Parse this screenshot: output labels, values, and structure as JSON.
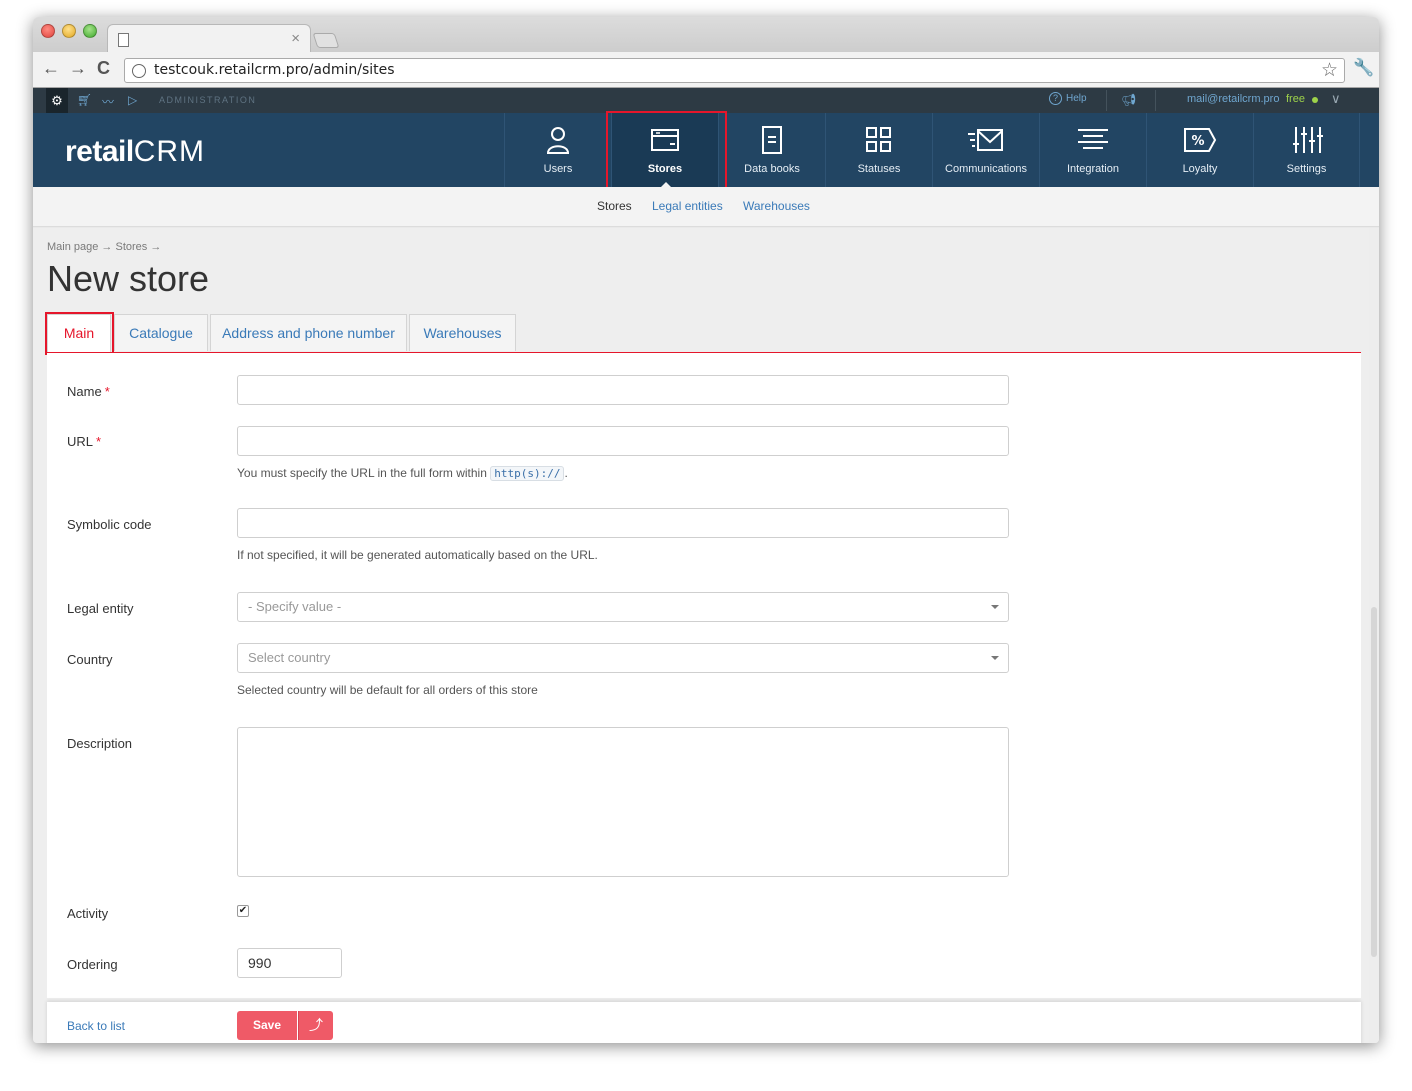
{
  "browser": {
    "url": "testcouk.retailcrm.pro/admin/sites"
  },
  "adminbar": {
    "label": "ADMINISTRATION",
    "help": "Help",
    "email": "mail@retailcrm.pro",
    "plan": "free"
  },
  "logo": {
    "text_a": "retail",
    "text_b": "CRM"
  },
  "nav": {
    "items": [
      {
        "label": "Users",
        "icon": "user-icon"
      },
      {
        "label": "Stores",
        "icon": "store-window-icon"
      },
      {
        "label": "Data books",
        "icon": "book-icon"
      },
      {
        "label": "Statuses",
        "icon": "statuses-grid-icon"
      },
      {
        "label": "Communications",
        "icon": "envelope-icon"
      },
      {
        "label": "Integration",
        "icon": "integration-lines-icon"
      },
      {
        "label": "Loyalty",
        "icon": "percent-tag-icon"
      },
      {
        "label": "Settings",
        "icon": "sliders-icon"
      }
    ],
    "active": "Stores"
  },
  "subnav": {
    "stores": "Stores",
    "legal": "Legal entities",
    "warehouses": "Warehouses"
  },
  "breadcrumb": "Main page → Stores →",
  "title": "New store",
  "tabs": [
    "Main",
    "Catalogue",
    "Address and phone number",
    "Warehouses"
  ],
  "form": {
    "name_label": "Name",
    "url_label": "URL",
    "required_mark": "*",
    "url_hint_prefix": "You must specify the URL in the full form within ",
    "url_hint_code": "http(s)://",
    "url_hint_suffix": ".",
    "code_label": "Symbolic code",
    "code_hint": "If not specified, it will be generated automatically based on the URL.",
    "legal_label": "Legal entity",
    "legal_placeholder": "- Specify value -",
    "country_label": "Country",
    "country_placeholder": "Select country",
    "country_hint": "Selected country will be default for all orders of this store",
    "description_label": "Description",
    "activity_label": "Activity",
    "activity_checked": true,
    "ordering_label": "Ordering",
    "ordering_value": "990"
  },
  "footer": {
    "back": "Back to list",
    "save": "Save",
    "up": "⤴"
  },
  "colors": {
    "nav_bg": "#224563",
    "admin_bar": "#2d3a44",
    "accent_red": "#e5162b",
    "save_button": "#ef5a67",
    "link_blue": "#3a7ab8"
  }
}
